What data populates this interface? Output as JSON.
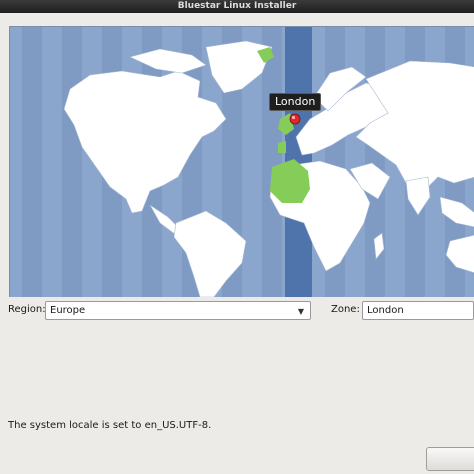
{
  "window": {
    "title": "Bluestar Linux Installer"
  },
  "map": {
    "ocean_color": "#8ba6cd",
    "land_color": "#ffffff",
    "selected_zone_color": "#4f73ab",
    "highlight_country_color": "#86cc58",
    "marker_color": "#e3262a",
    "selected_city_label": "London"
  },
  "region": {
    "label": "Region:",
    "value": "Europe"
  },
  "zone": {
    "label": "Zone:",
    "value": "London"
  },
  "status": {
    "locale_message": "The system locale is set to en_US.UTF-8."
  }
}
